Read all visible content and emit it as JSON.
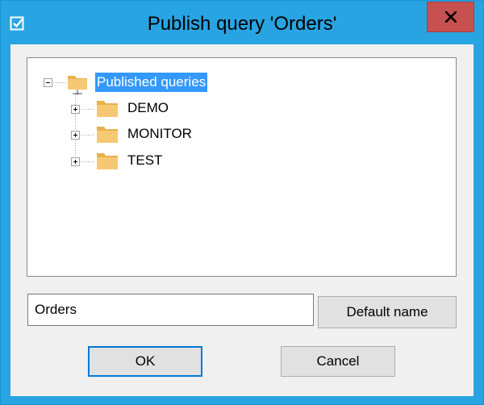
{
  "window": {
    "title": "Publish query 'Orders'",
    "accent_color": "#29a4e2",
    "close_button_color": "#c75050",
    "app_icon": "checkbox-app-icon",
    "close_icon": "close-x-icon"
  },
  "tree": {
    "root": {
      "label": "Published queries",
      "expanded": true,
      "selected": true,
      "icon": "network-folder-icon",
      "children": [
        {
          "label": "DEMO",
          "expanded": false,
          "icon": "folder-icon"
        },
        {
          "label": "MONITOR",
          "expanded": false,
          "icon": "folder-icon"
        },
        {
          "label": "TEST",
          "expanded": false,
          "icon": "folder-icon"
        }
      ]
    },
    "selection_color": "#3399ff"
  },
  "name_field": {
    "value": "Orders"
  },
  "buttons": {
    "default_name": "Default name",
    "ok": "OK",
    "cancel": "Cancel"
  }
}
